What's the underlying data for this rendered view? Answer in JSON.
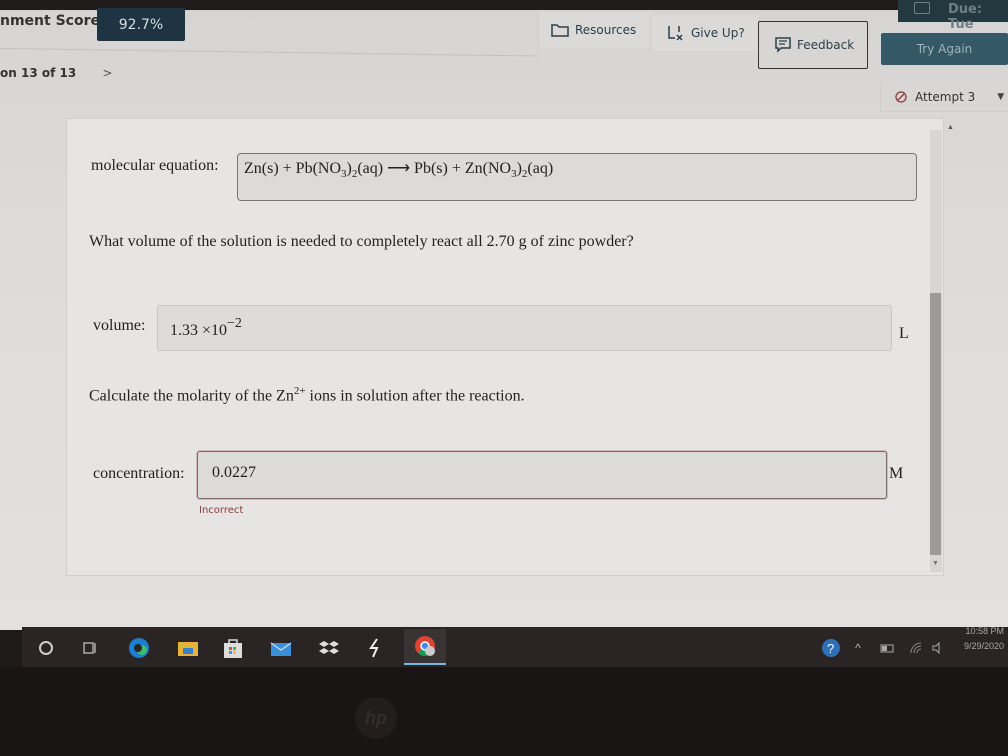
{
  "header": {
    "score_label": "nment Score:",
    "score_value": "92.7%",
    "question_nav": "on 13 of 13",
    "next_icon": "chevron-right-icon",
    "due_text": "Due: Tue"
  },
  "toolbar": {
    "resources_label": "Resources",
    "giveup_label": "Give Up?",
    "feedback_label": "Feedback",
    "tryagain_label": "Try Again",
    "attempt_label": "Attempt 3"
  },
  "question": {
    "equation_label": "molecular equation:",
    "equation": {
      "lhs1": "Zn(s) + Pb(NO",
      "sub1": "3",
      "mid1": ")",
      "sub2": "2",
      "mid2": "(aq)",
      "arrow": " ⟶ ",
      "rhs1": "Pb(s) + Zn(NO",
      "sub3": "3",
      "mid3": ")",
      "sub4": "2",
      "rhs2": "(aq)"
    },
    "volume_prompt": "What volume of the solution is needed to completely react all 2.70 g of zinc powder?",
    "volume_label": "volume:",
    "volume_mantissa": "1.33  ×10",
    "volume_exponent": "−2",
    "volume_unit": "L",
    "molarity_prompt_pre": "Calculate the molarity of the Zn",
    "molarity_prompt_sup": "2+",
    "molarity_prompt_post": " ions in solution after the reaction.",
    "concentration_label": "concentration:",
    "concentration_value": "0.0227",
    "concentration_unit": "M",
    "feedback_status": "Incorrect"
  },
  "taskbar": {
    "apps": [
      "search-circle",
      "task-view",
      "edge",
      "file-explorer",
      "store",
      "mail",
      "dropbox",
      "app-bolt",
      "chrome"
    ],
    "time": "10:58 PM",
    "date": "9/29/2020"
  },
  "colors": {
    "score_badge": "#1e3442",
    "try_again": "#355866",
    "incorrect": "#8a3a3a"
  }
}
